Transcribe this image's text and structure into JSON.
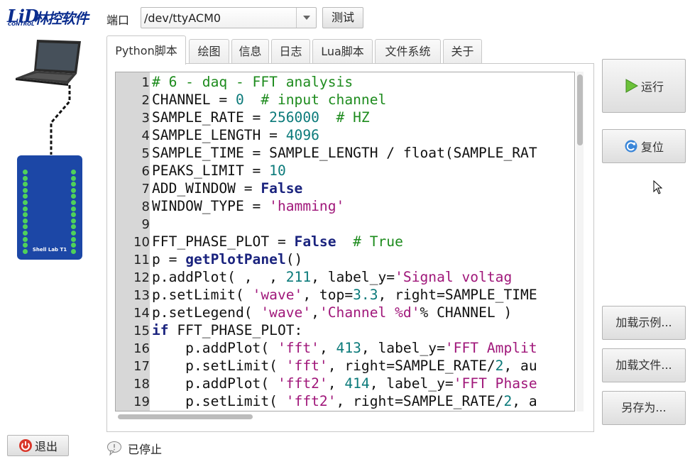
{
  "logo": {
    "brand": "LiD",
    "control": "CONTROL",
    "company": "林控软件"
  },
  "port": {
    "label": "端口",
    "value": "/dev/ttyACM0",
    "test_label": "测试"
  },
  "tabs": [
    "Python脚本",
    "绘图",
    "信息",
    "日志",
    "Lua脚本",
    "文件系统",
    "关于"
  ],
  "device": {
    "label": "Shell Lab T1"
  },
  "editor": {
    "line_numbers": [
      "1",
      "2",
      "3",
      "4",
      "5",
      "6",
      "7",
      "8",
      "9",
      "10",
      "11",
      "12",
      "13",
      "14",
      "15",
      "16",
      "17",
      "18",
      "19"
    ]
  },
  "buttons": {
    "run": "运行",
    "reset": "复位",
    "load_example": "加载示例...",
    "load_file": "加载文件...",
    "save_as": "另存为...",
    "quit": "退出"
  },
  "status": {
    "text": "已停止"
  },
  "colors": {
    "keyword": "#1a237e",
    "number": "#0b7a7a",
    "string": "#a0177a",
    "comment": "#1d8b1d",
    "gutter": "#d7d7d7"
  }
}
